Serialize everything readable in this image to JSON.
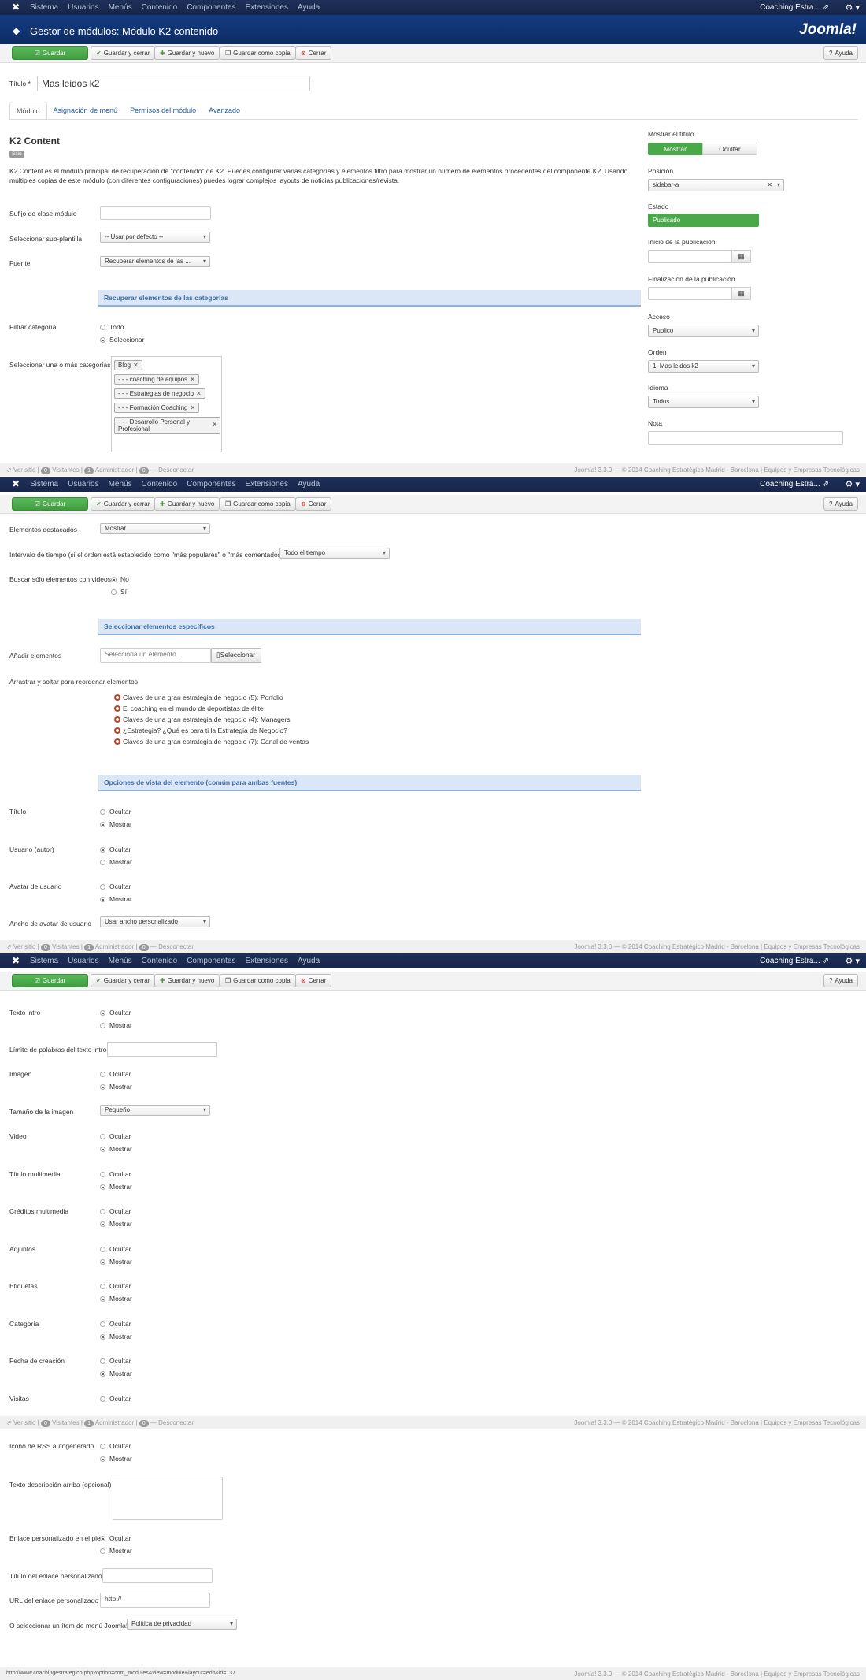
{
  "nav": {
    "menu": [
      "Sistema",
      "Usuarios",
      "Menús",
      "Contenido",
      "Componentes",
      "Extensiones",
      "Ayuda"
    ],
    "site_name": "Coaching Estra...",
    "external_icon": "external-link-icon",
    "settings_icon": "gear-icon"
  },
  "header": {
    "title": "Gestor de módulos: Módulo K2 contenido",
    "logo": "Joomla!"
  },
  "toolbar": {
    "save": "Guardar",
    "save_close": "Guardar y cerrar",
    "save_new": "Guardar y nuevo",
    "save_copy": "Guardar como copia",
    "close": "Cerrar",
    "help": "Ayuda"
  },
  "form": {
    "title_label": "Título *",
    "title_value": "Mas leidos k2"
  },
  "tabs": [
    "Módulo",
    "Asignación de menú",
    "Permisos del módulo",
    "Avanzado"
  ],
  "module": {
    "heading": "K2 Content",
    "badge": "Sitio",
    "description": "K2 Content es el módulo principal de recuperación de \"contenido\" de K2. Puedes configurar varias categorías y elementos filtro para mostrar un número de elementos procedentes del componente K2. Usando múltiples copias de este módulo (con diferentes configuraciones) puedes lograr complejos layouts de noticias publicaciones/revista.",
    "suffix_label": "Sufijo de clase módulo",
    "subtemplate_label": "Seleccionar sub-plantilla",
    "subtemplate_value": "-- Usar por defecto --",
    "source_label": "Fuente",
    "source_value": "Recuperar elementos de las ...",
    "section_categories": "Recuperar elementos de las categorías",
    "filter_label": "Filtrar categoría",
    "filter_all": "Todo",
    "filter_select": "Seleccionar",
    "select_cats_label": "Seleccionar una o más categorías",
    "categories": [
      "Blog",
      "- - - coaching de equipos",
      "- - - Estrategias de negocio",
      "- - - Formación Coaching",
      "- - - Desarrollo Personal y Profesional"
    ]
  },
  "sidebar": {
    "show_title_label": "Mostrar el título",
    "show": "Mostrar",
    "hide": "Ocultar",
    "position_label": "Posición",
    "position_value": "sidebar-a",
    "status_label": "Estado",
    "status_value": "Publicado",
    "start_label": "Inicio de la publicación",
    "end_label": "Finalización de la publicación",
    "access_label": "Acceso",
    "access_value": "Publico",
    "order_label": "Orden",
    "order_value": "1. Mas leidos k2",
    "language_label": "Idioma",
    "language_value": "Todos",
    "note_label": "Nota"
  },
  "footer": {
    "view_site": "Ver sitio",
    "visitors_count": "0",
    "visitors": "Visitantes",
    "admin_count": "1",
    "admin": "Administrador",
    "logout_count": "0",
    "logout": "Desconectar",
    "right": "Joomla! 3.3.0 — © 2014 Coaching Estratégico Madrid - Barcelona | Equipos y Empresas Tecnológicas"
  },
  "part2": {
    "featured_label": "Elementos destacados",
    "featured_value": "Mostrar",
    "interval_label": "Intervalo de tiempo (si el orden está establecido como \"más populares\" o \"más comentados\")",
    "interval_value": "Todo el tiempo",
    "videos_label": "Buscar sólo elementos con videos",
    "no": "No",
    "yes": "Sí",
    "section_specific": "Seleccionar elementos específicos",
    "add_label": "Añadir elementos",
    "add_placeholder": "Selecciona un elemento...",
    "add_button": "Seleccionar",
    "drag_label": "Arrastrar y soltar para reordenar elementos",
    "items": [
      "Claves de una gran estrategia de negocio (5): Porfolio",
      "El coaching en el mundo de deportistas de élite",
      "Claves de una gran estrategia de negocio (4): Managers",
      "¿Estrategia? ¿Qué es para ti la Estrategia de Negocio?",
      "Claves de una gran estrategia de negocio (7): Canal de ventas"
    ],
    "section_view": "Opciones de vista del elemento (común para ambas fuentes)",
    "title_label": "Título",
    "user_label": "Usuario (autor)",
    "avatar_label": "Avatar de usuario",
    "avatar_width_label": "Ancho de avatar de usuario",
    "avatar_width_value": "Usar ancho personalizado",
    "hide": "Ocultar",
    "show": "Mostrar"
  },
  "part3": {
    "intro_label": "Texto intro",
    "limit_label": "Límite de palabras del texto intro",
    "image_label": "Imagen",
    "image_size_label": "Tamaño de la imagen",
    "image_size_value": "Pequeño",
    "video_label": "Video",
    "media_title_label": "Título multimedia",
    "media_credits_label": "Créditos multimedia",
    "attachments_label": "Adjuntos",
    "tags_label": "Etiquetas",
    "category_label": "Categoría",
    "created_label": "Fecha de creación",
    "visits_label": "Visitas",
    "hide": "Ocultar",
    "show": "Mostrar"
  },
  "part4": {
    "rss_label": "Icono de RSS autogenerado",
    "desc_label": "Texto descripción arriba (opcional)",
    "footer_link_label": "Enlace personalizado en el pie",
    "link_title_label": "Título del enlace personalizado",
    "link_url_label": "URL del enlace personalizado",
    "link_url_value": "http://",
    "menu_item_label": "O seleccionar un ítem de menú Joomla!",
    "menu_item_value": "Política de privacidad",
    "hide": "Ocultar",
    "show": "Mostrar",
    "status_url": "http://www.coachingestrategico.php?option=com_modules&view=module&layout=edit&id=137"
  }
}
